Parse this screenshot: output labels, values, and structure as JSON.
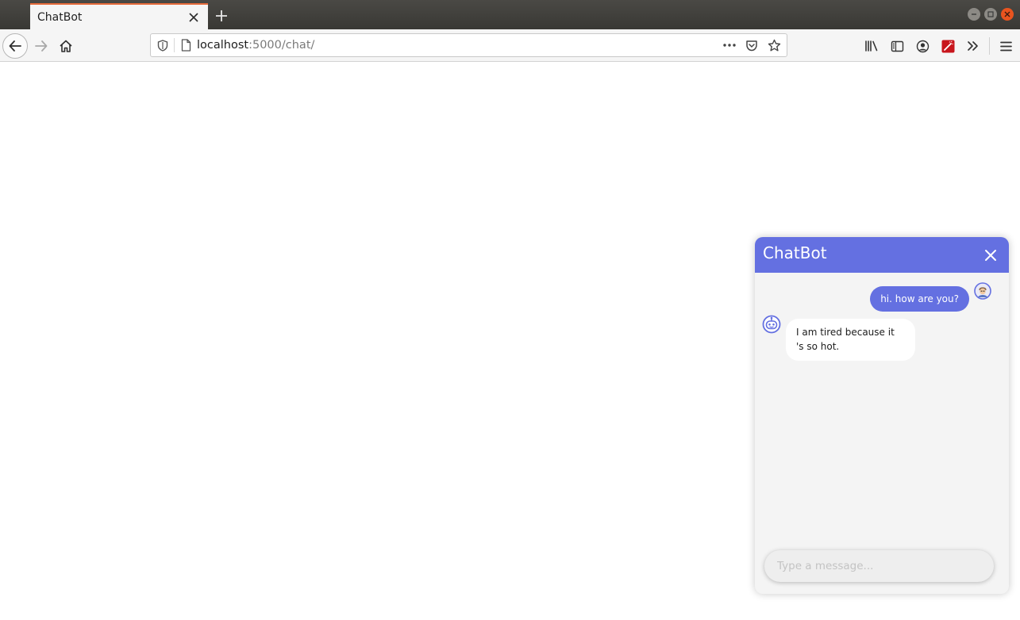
{
  "browser": {
    "tab_title": "ChatBot",
    "url_host": "localhost",
    "url_path": ":5000/chat/"
  },
  "chat": {
    "title": "ChatBot",
    "accent_color": "#6470e1",
    "messages": [
      {
        "sender": "user",
        "text": "hi. how are you?"
      },
      {
        "sender": "bot",
        "text": "I am tired because it 's so hot."
      }
    ],
    "input": {
      "placeholder": "Type a message...",
      "value": ""
    }
  },
  "icons": {
    "tab_close": "close-icon",
    "new_tab": "plus-icon",
    "back": "arrow-left-icon",
    "forward": "arrow-right-icon",
    "home": "home-icon",
    "shield": "shield-icon",
    "page": "page-icon",
    "more": "more-dots-icon",
    "pocket": "pocket-icon",
    "bookmark": "star-icon",
    "library": "library-icon",
    "sidebar": "sidebar-icon",
    "account": "account-icon",
    "extension": "extension-icon",
    "overflow": "chevron-double-right-icon",
    "menu": "hamburger-menu-icon",
    "chat_close": "close-icon",
    "user_avatar": "user-avatar-icon",
    "bot_avatar": "robot-avatar-icon"
  }
}
